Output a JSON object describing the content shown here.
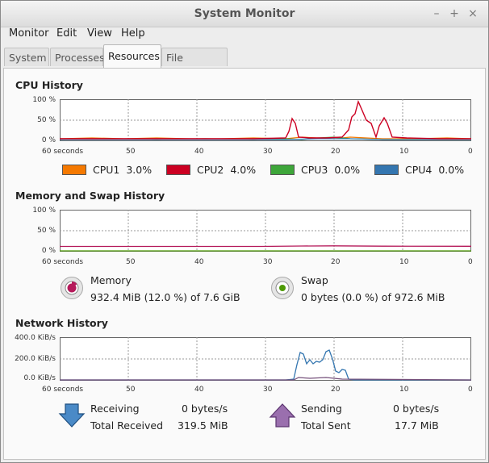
{
  "window": {
    "title": "System Monitor",
    "buttons": [
      "–",
      "+",
      "×"
    ]
  },
  "menu": {
    "items": [
      "Monitor",
      "Edit",
      "View",
      "Help"
    ]
  },
  "tabs": [
    {
      "label": "System",
      "active": false
    },
    {
      "label": "Processes",
      "active": false
    },
    {
      "label": "Resources",
      "active": true
    },
    {
      "label": "File Systems",
      "active": false
    }
  ],
  "cpu": {
    "title": "CPU History",
    "y_ticks": [
      "100 %",
      "50 %",
      "0 %"
    ],
    "x_ticks": [
      "60 seconds",
      "50",
      "40",
      "30",
      "20",
      "10",
      "0"
    ],
    "legend": [
      {
        "name": "CPU1",
        "value": "3.0%",
        "color": "#f57900"
      },
      {
        "name": "CPU2",
        "value": "4.0%",
        "color": "#cc0022"
      },
      {
        "name": "CPU3",
        "value": "0.0%",
        "color": "#3ea63a"
      },
      {
        "name": "CPU4",
        "value": "0.0%",
        "color": "#3476b0"
      }
    ]
  },
  "memory": {
    "title": "Memory and Swap History",
    "y_ticks": [
      "100 %",
      "50 %",
      "0 %"
    ],
    "x_ticks": [
      "60 seconds",
      "50",
      "40",
      "30",
      "20",
      "10",
      "0"
    ],
    "memory_label": "Memory",
    "memory_value": "932.4 MiB (12.0 %) of 7.6 GiB",
    "memory_color": "#b5195a",
    "swap_label": "Swap",
    "swap_value": "0 bytes (0.0 %) of 972.6 MiB",
    "swap_color": "#4e9a06"
  },
  "network": {
    "title": "Network History",
    "y_ticks": [
      "400.0 KiB/s",
      "200.0 KiB/s",
      "0.0 KiB/s"
    ],
    "x_ticks": [
      "60 seconds",
      "50",
      "40",
      "30",
      "20",
      "10",
      "0"
    ],
    "receiving_label": "Receiving",
    "receiving_value": "0 bytes/s",
    "total_received_label": "Total Received",
    "total_received_value": "319.5 MiB",
    "sending_label": "Sending",
    "sending_value": "0 bytes/s",
    "total_sent_label": "Total Sent",
    "total_sent_value": "17.7 MiB",
    "receiving_color": "#3476b0",
    "sending_color": "#75507b"
  }
}
